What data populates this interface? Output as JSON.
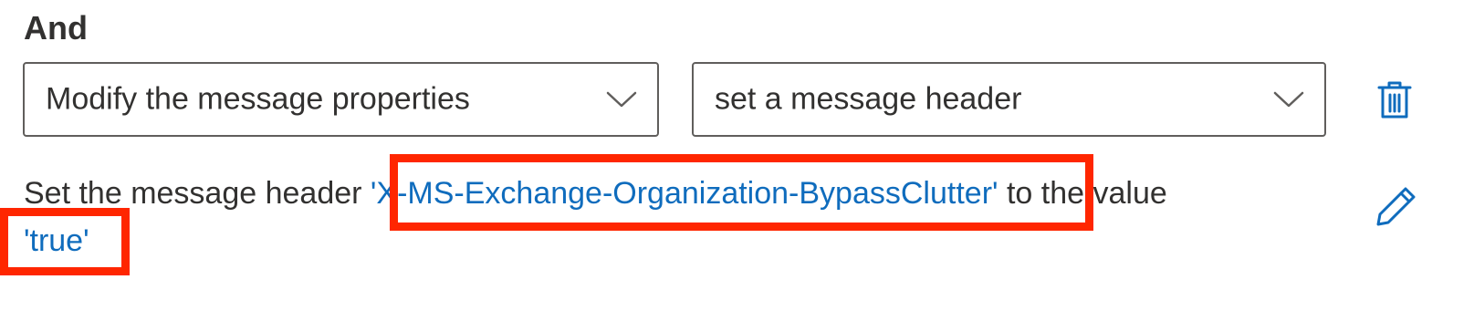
{
  "section": {
    "label": "And"
  },
  "action": {
    "category_value": "Modify the message properties",
    "subaction_value": "set a message header"
  },
  "description": {
    "prefix": "Set the message header",
    "header_name": "'X-MS-Exchange-Organization-BypassClutter'",
    "middle": "to the value",
    "header_value": "'true'"
  },
  "icons": {
    "chevron": "chevron-down-icon",
    "delete": "trash-icon",
    "edit": "pencil-icon"
  },
  "colors": {
    "link": "#0f6cbd",
    "highlight": "#ff2600",
    "icon": "#0f6cbd",
    "text": "#323130",
    "border": "#605e5c"
  }
}
